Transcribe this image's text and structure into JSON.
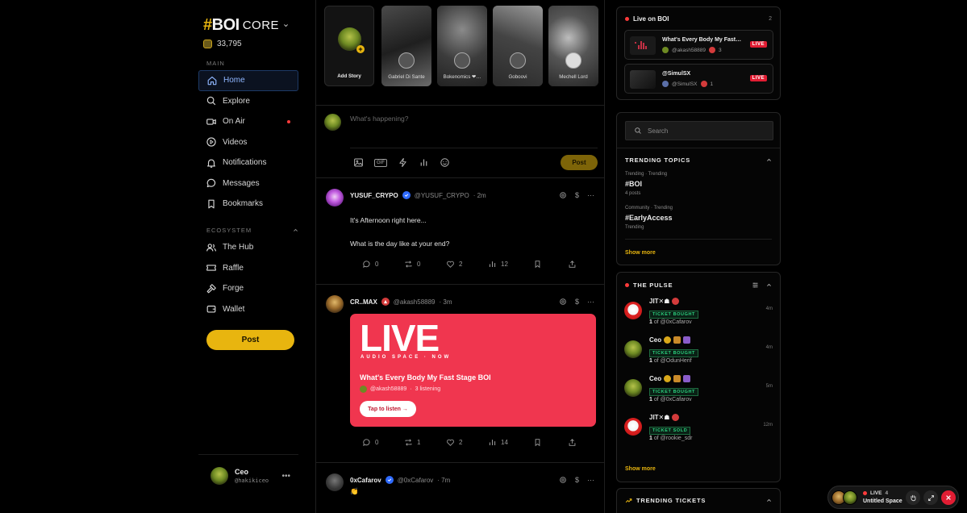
{
  "brand": {
    "hash": "#",
    "name": "BOI",
    "suffix": "CORE"
  },
  "balance": "33,795",
  "sidebar": {
    "main_label": "MAIN",
    "items": [
      {
        "label": "Home",
        "icon": "home-icon"
      },
      {
        "label": "Explore",
        "icon": "search-icon"
      },
      {
        "label": "On Air",
        "icon": "video-camera-icon"
      },
      {
        "label": "Videos",
        "icon": "play-circle-icon"
      },
      {
        "label": "Notifications",
        "icon": "bell-icon"
      },
      {
        "label": "Messages",
        "icon": "chat-bubble-icon"
      },
      {
        "label": "Bookmarks",
        "icon": "bookmark-icon"
      }
    ],
    "ecosystem_label": "ECOSYSTEM",
    "eco_items": [
      {
        "label": "The Hub",
        "icon": "users-icon"
      },
      {
        "label": "Raffle",
        "icon": "ticket-icon"
      },
      {
        "label": "Forge",
        "icon": "hammer-icon"
      },
      {
        "label": "Wallet",
        "icon": "wallet-icon"
      }
    ],
    "post_label": "Post",
    "user": {
      "name": "Ceo",
      "handle": "@hakikiceo"
    }
  },
  "stories": [
    {
      "name": "Add Story"
    },
    {
      "name": "Gabriel Di Sante"
    },
    {
      "name": "Bokenomics ❤…"
    },
    {
      "name": "Goboovi"
    },
    {
      "name": "Mechell Lord"
    }
  ],
  "composer": {
    "placeholder": "What's happening?",
    "gif": "GIF",
    "post_label": "Post"
  },
  "posts": [
    {
      "name": "YUSUF_CRYPO",
      "handle": "@YUSUF_CRYPO",
      "time": "· 2m",
      "line1": "It's Afternoon right here...",
      "line2": "What is the day like at your end?",
      "replies": "0",
      "reposts": "0",
      "likes": "2",
      "views": "12"
    },
    {
      "name": "CR..MAX",
      "handle": "@akash58889",
      "time": "· 3m",
      "card": {
        "big": "LIVE",
        "sub": "AUDIO SPACE · NOW",
        "title": "What's Every Body My Fast Stage BOI",
        "host": "@akash58889",
        "listening": "3 listening",
        "cta": "Tap to listen →"
      },
      "replies": "0",
      "reposts": "1",
      "likes": "2",
      "views": "14"
    },
    {
      "name": "0xCafarov",
      "handle": "@0xCafarov",
      "time": "· 7m",
      "emoji": "👏"
    }
  ],
  "live_panel": {
    "title": "Live on BOI",
    "count": "2",
    "items": [
      {
        "title": "What's Every Body My Fast…",
        "host": "@akash58889",
        "listeners": "3",
        "tag": "LIVE"
      },
      {
        "title": "@SimulSX",
        "host": "@SimulSX",
        "listeners": "1",
        "tag": "LIVE"
      }
    ]
  },
  "search": {
    "placeholder": "Search"
  },
  "trending": {
    "title": "TRENDING TOPICS",
    "topics": [
      {
        "meta": "Trending · Trending",
        "tag": "#BOI",
        "sub": "4 posts"
      },
      {
        "meta": "Community · Trending",
        "tag": "#EarlyAccess",
        "sub": "Trending"
      }
    ],
    "show_more": "Show more"
  },
  "pulse": {
    "title": "THE PULSE",
    "items": [
      {
        "name": "JIT✕☗",
        "badge": "TICKET BOUGHT",
        "qty": "1",
        "of": "of @0xCafarov",
        "time": "4m"
      },
      {
        "name": "Ceo",
        "badge": "TICKET BOUGHT",
        "qty": "1",
        "of": "of @OdunHerif",
        "time": "4m"
      },
      {
        "name": "Ceo",
        "badge": "TICKET BOUGHT",
        "qty": "1",
        "of": "of @0xCafarov",
        "time": "5m"
      },
      {
        "name": "JIT✕☗",
        "badge": "TICKET SOLD",
        "qty": "1",
        "of": "of @rookie_sdr",
        "time": "12m"
      }
    ],
    "show_more": "Show more"
  },
  "tickets": {
    "title": "TRENDING TICKETS"
  },
  "float_bar": {
    "live": "LIVE",
    "count": "4",
    "title": "Untitled Space"
  },
  "colors": {
    "accent": "#e8b50f",
    "live_red": "#f0364f",
    "active_blue": "#8fb6ff"
  }
}
